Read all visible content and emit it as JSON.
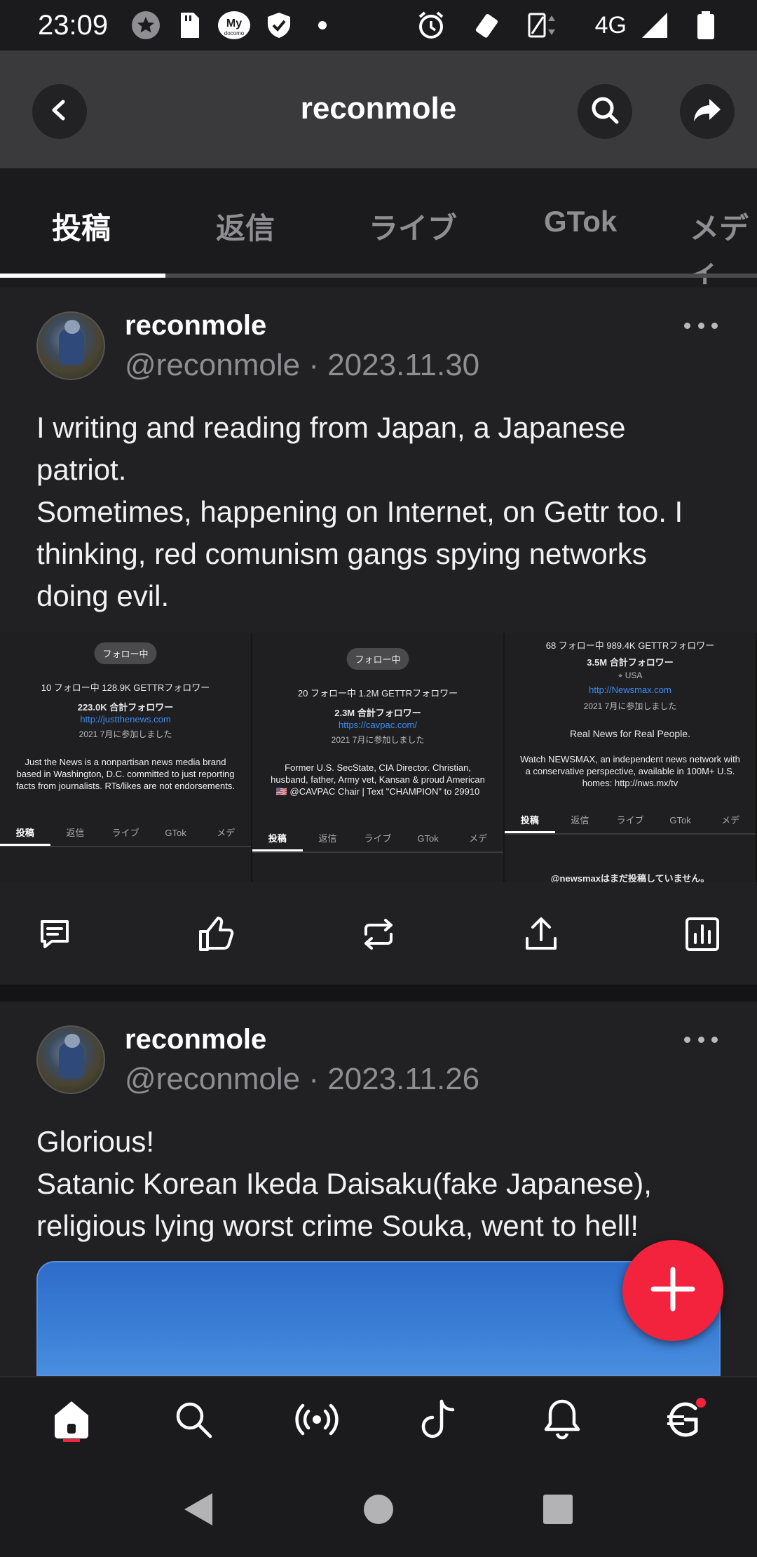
{
  "status_bar": {
    "time": "23:09",
    "network": "4G",
    "icons": [
      "star-icon",
      "sd-card-icon",
      "docomo-icon",
      "shield-icon",
      "dot-icon",
      "alarm-icon",
      "vibrate-icon",
      "signal-icon",
      "battery-icon"
    ],
    "docomo_label": "My",
    "docomo_sub": "docomo"
  },
  "header": {
    "title": "reconmole"
  },
  "tabs": [
    {
      "label": "投稿",
      "active": true
    },
    {
      "label": "返信",
      "active": false
    },
    {
      "label": "ライブ",
      "active": false
    },
    {
      "label": "GTok",
      "active": false
    },
    {
      "label": "メディ",
      "active": false
    }
  ],
  "posts": [
    {
      "name": "reconmole",
      "meta": "@reconmole · 2023.11.30",
      "text_lines": [
        "I writing and reading from Japan, a Japanese",
        "patriot.",
        "Sometimes, happening on Internet, on Gettr too. I",
        "thinking, red comunism gangs spying networks",
        "doing evil."
      ],
      "screenshots": [
        {
          "pill": "フォロー中",
          "stats_line": "10 フォロー中   128.9K GETTRフォロワー",
          "total": "223.0K 合計フォロワー",
          "link": "http://justthenews.com",
          "joined": "2021 7月に参加しました",
          "bio": "Just the News is a nonpartisan news media brand based in Washington, D.C. committed to just reporting facts from journalists. RTs/likes are not endorsements.",
          "tabs": [
            "投稿",
            "返信",
            "ライブ",
            "GTok",
            "メデ"
          ]
        },
        {
          "pill": "フォロー中",
          "stats_line": "20 フォロー中   1.2M GETTRフォロワー",
          "total": "2.3M 合計フォロワー",
          "link": "https://cavpac.com/",
          "joined": "2021 7月に参加しました",
          "bio": "Former U.S. SecState, CIA Director. Christian, husband, father, Army vet, Kansan & proud American 🇺🇸 @CAVPAC Chair | Text \"CHAMPION\" to 29910",
          "tabs": [
            "投稿",
            "返信",
            "ライブ",
            "GTok",
            "メデ"
          ]
        },
        {
          "stats_line": "68 フォロー中   989.4K GETTRフォロワー",
          "total": "3.5M 合計フォロワー",
          "location": "USA",
          "link": "http://Newsmax.com",
          "joined": "2021 7月に参加しました",
          "headline": "Real News for Real People.",
          "bio": "Watch NEWSMAX, an independent news network with a conservative perspective, available in 100M+ U.S. homes: http://nws.mx/tv",
          "tabs": [
            "投稿",
            "返信",
            "ライブ",
            "GTok",
            "メデ"
          ],
          "footer": "@newsmaxはまだ投稿していません。"
        }
      ]
    },
    {
      "name": "reconmole",
      "meta": "@reconmole · 2023.11.26",
      "text_lines": [
        "Glorious!",
        "Satanic Korean Ikeda Daisaku(fake Japanese),",
        "religious lying worst crime Souka, went to hell!"
      ]
    }
  ],
  "actions": [
    "comment-icon",
    "like-icon",
    "repost-icon",
    "share-icon",
    "stats-icon"
  ],
  "bottom_nav": [
    "home-icon",
    "search-icon",
    "live-icon",
    "gtok-icon",
    "notifications-icon",
    "gettr-wallet-icon"
  ],
  "colors": {
    "accent": "#f3233e",
    "background": "#212123",
    "header": "#3a3a3c",
    "link": "#3a8df5"
  }
}
